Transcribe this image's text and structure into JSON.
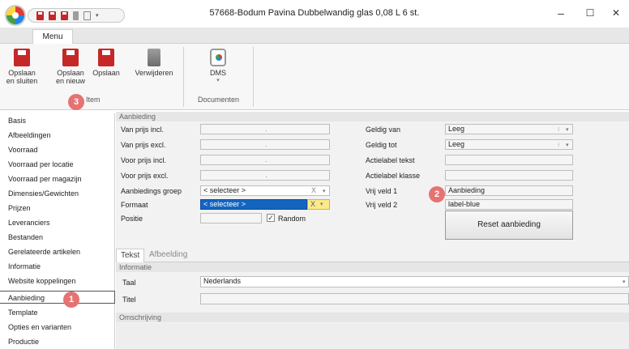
{
  "window": {
    "title": "57668-Bodum Pavina Dubbelwandig glas 0,08 L 6 st.",
    "minimize": "–",
    "maximize": "☐",
    "close": "✕"
  },
  "qat": {
    "dropdown": "▾",
    "sep": "|₹"
  },
  "ribbon": {
    "tab_menu": "Menu",
    "buttons": [
      {
        "label": "Opslaan en sluiten",
        "icon": "save-close-icon"
      },
      {
        "label": "Opslaan en nieuw",
        "icon": "save-new-icon"
      },
      {
        "label": "Opslaan",
        "icon": "save-icon"
      },
      {
        "label": "Verwijderen",
        "icon": "delete-icon"
      },
      {
        "label": "DMS",
        "icon": "dms-icon"
      }
    ],
    "dms_arrow": "▾",
    "group_item": "Item",
    "group_documenten": "Documenten"
  },
  "badges": {
    "one": "1",
    "two": "2",
    "three": "3"
  },
  "sidebar": {
    "items": [
      "Basis",
      "Afbeeldingen",
      "Voorraad",
      "Voorraad per locatie",
      "Voorraad per magazijn",
      "Dimensies/Gewichten",
      "Prijzen",
      "Leveranciers",
      "Bestanden",
      "Gerelateerde artikelen",
      "Informatie",
      "Website koppelingen",
      "Aanbieding",
      "Template",
      "Opties en varianten",
      "Productie"
    ],
    "selected": "Aanbieding"
  },
  "aanbieding": {
    "header": "Aanbieding",
    "van_prijs_incl": "Van prijs incl.",
    "van_prijs_excl": "Van prijs excl.",
    "voor_prijs_incl": "Voor prijs incl.",
    "voor_prijs_excl": "Voor prijs excl.",
    "aanbiedings_groep": "Aanbiedings groep",
    "formaat": "Formaat",
    "positie": "Positie",
    "dot": ".",
    "selecteer": "< selecteer >",
    "x": "X",
    "arrow": "▾",
    "random": "Random",
    "check": "✓",
    "geldig_van": "Geldig van",
    "geldig_tot": "Geldig tot",
    "actielabel_tekst": "Actielabel tekst",
    "actielabel_klasse": "Actielabel klasse",
    "vrij_veld_1": "Vrij veld 1",
    "vrij_veld_2": "Vrij veld 2",
    "leeg": "Leeg",
    "spin": "⁝",
    "vrij_veld_1_value": "Aanbieding",
    "vrij_veld_2_value": "label-blue",
    "reset": "Reset aanbieding"
  },
  "tabs": {
    "tekst": "Tekst",
    "afbeelding": "Afbeelding"
  },
  "informatie": {
    "header": "Informatie",
    "taal_label": "Taal",
    "taal_value": "Nederlands",
    "titel_label": "Titel",
    "omschrijving": "Omschrijving"
  }
}
